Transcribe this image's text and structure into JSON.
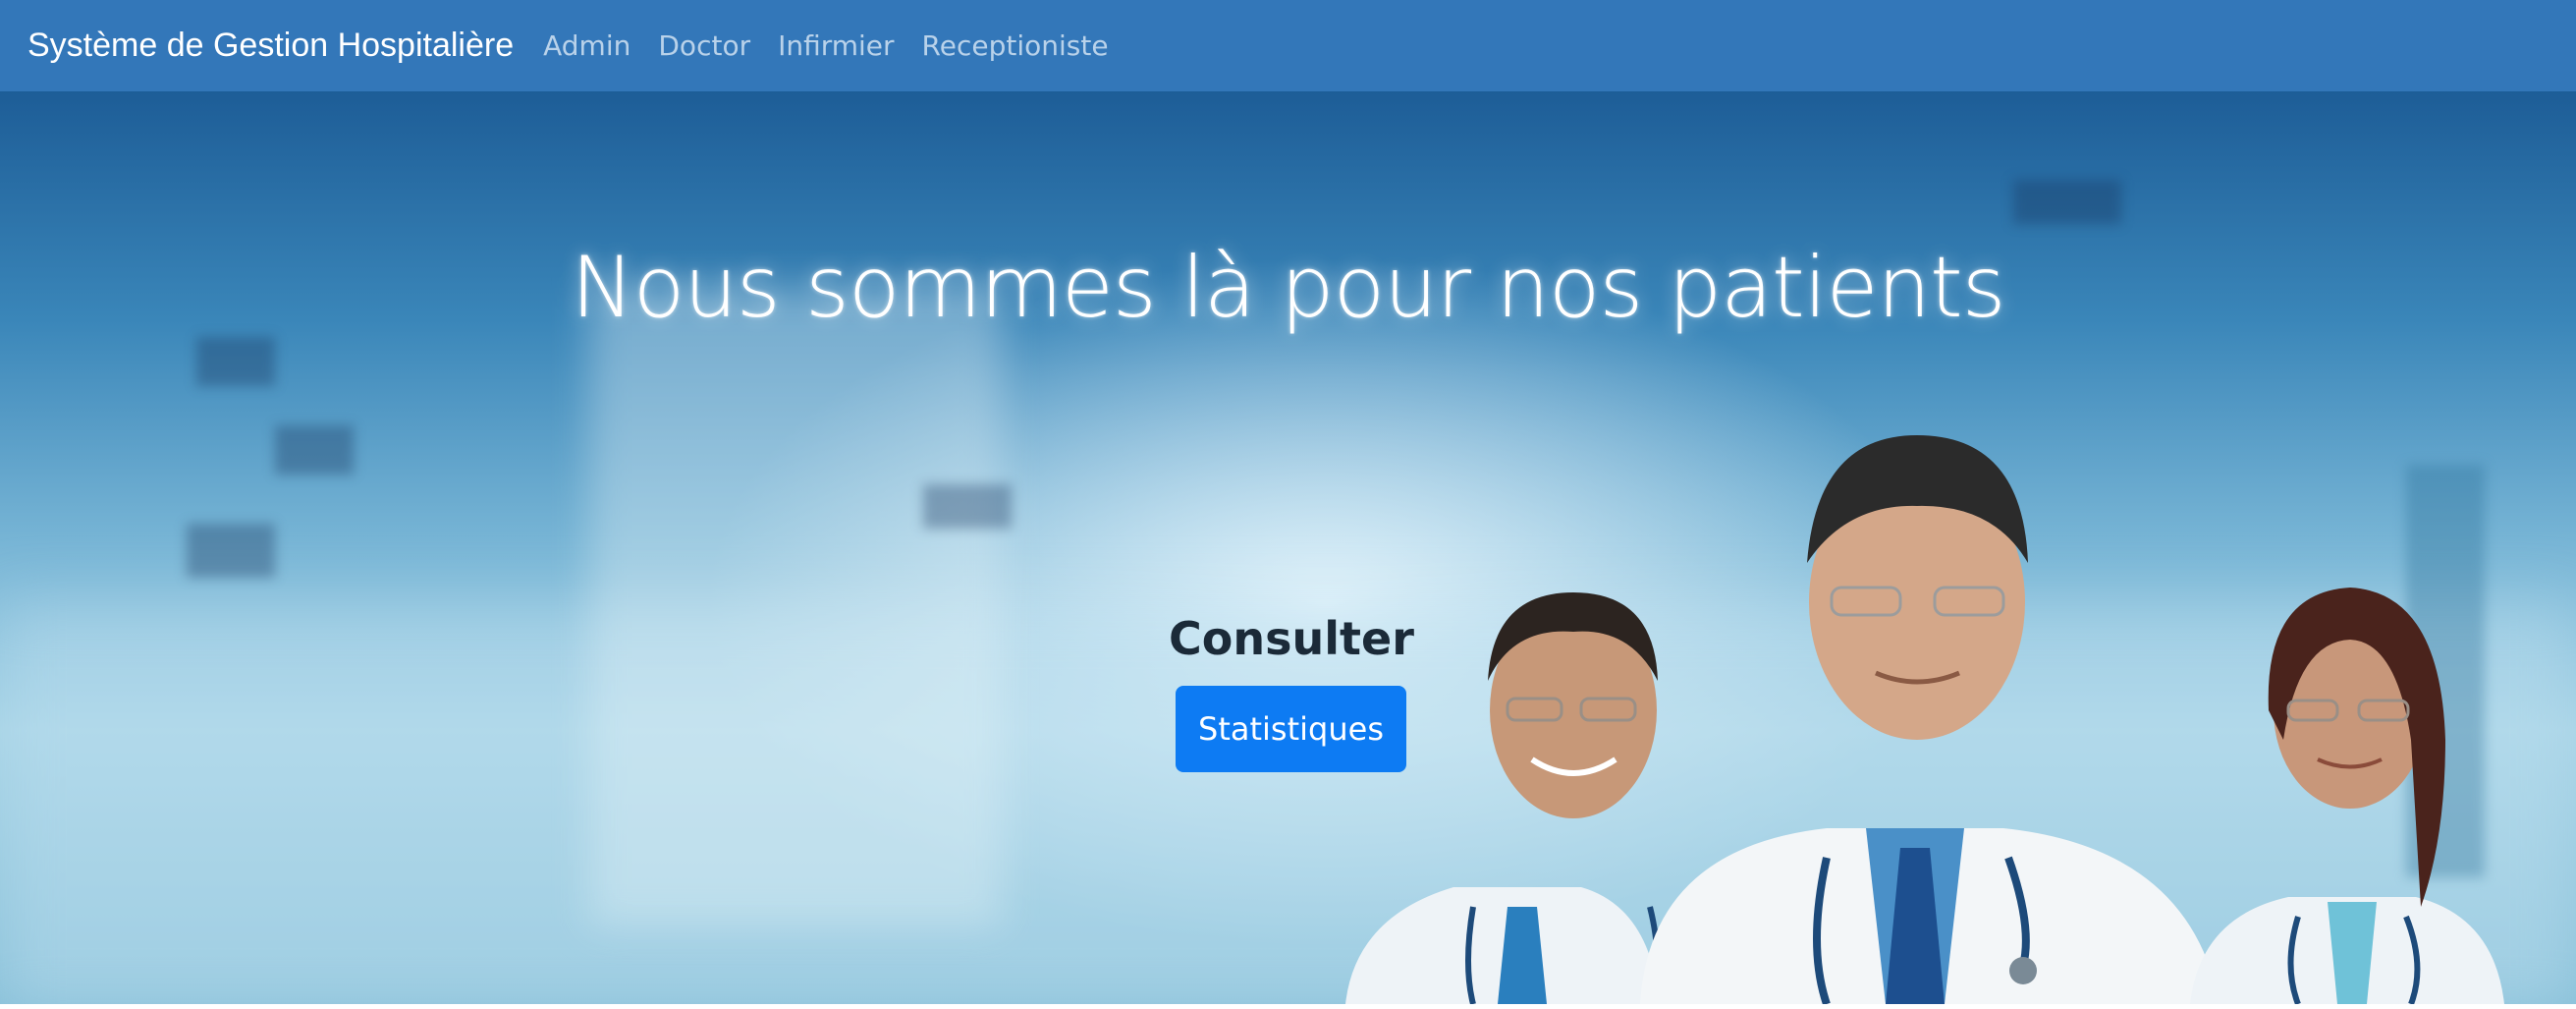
{
  "navbar": {
    "brand": "Système de Gestion Hospitalière",
    "links": [
      "Admin",
      "Doctor",
      "Infirmier",
      "Receptioniste"
    ]
  },
  "hero": {
    "title": "Nous sommes là pour nos patients",
    "consult_label": "Consulter",
    "stats_button": "Statistiques",
    "image": "hospital-doctors-illustration"
  },
  "colors": {
    "navbar": "#3377b9",
    "button": "#0d7bf3",
    "link": "#b9d2ea"
  }
}
